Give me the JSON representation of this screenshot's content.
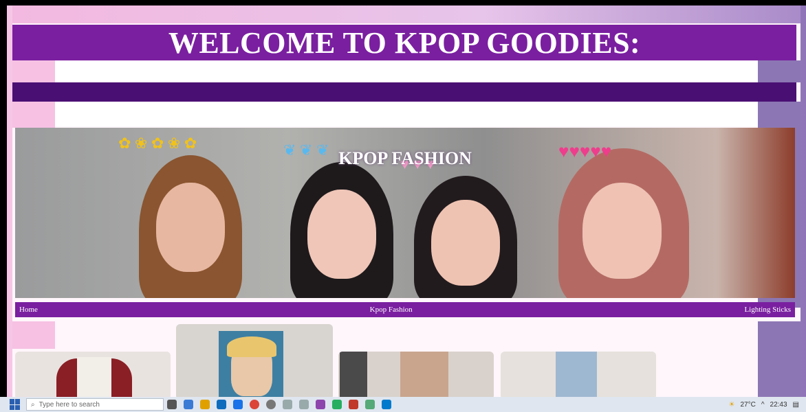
{
  "header": {
    "title": "WELCOME TO KPOP GOODIES:"
  },
  "banner": {
    "title": "KPOP FASHION"
  },
  "nav": {
    "items": [
      "Home",
      "Kpop Fashion",
      "Lighting Sticks"
    ]
  },
  "taskbar": {
    "search_placeholder": "Type here to search",
    "temperature": "27°C",
    "time": "22:43"
  },
  "colors": {
    "header_bg": "#7a1fa0",
    "dark_bar": "#4a0f73",
    "pink_accent": "#f6c1e3",
    "lavender_accent": "#8c77b4"
  }
}
